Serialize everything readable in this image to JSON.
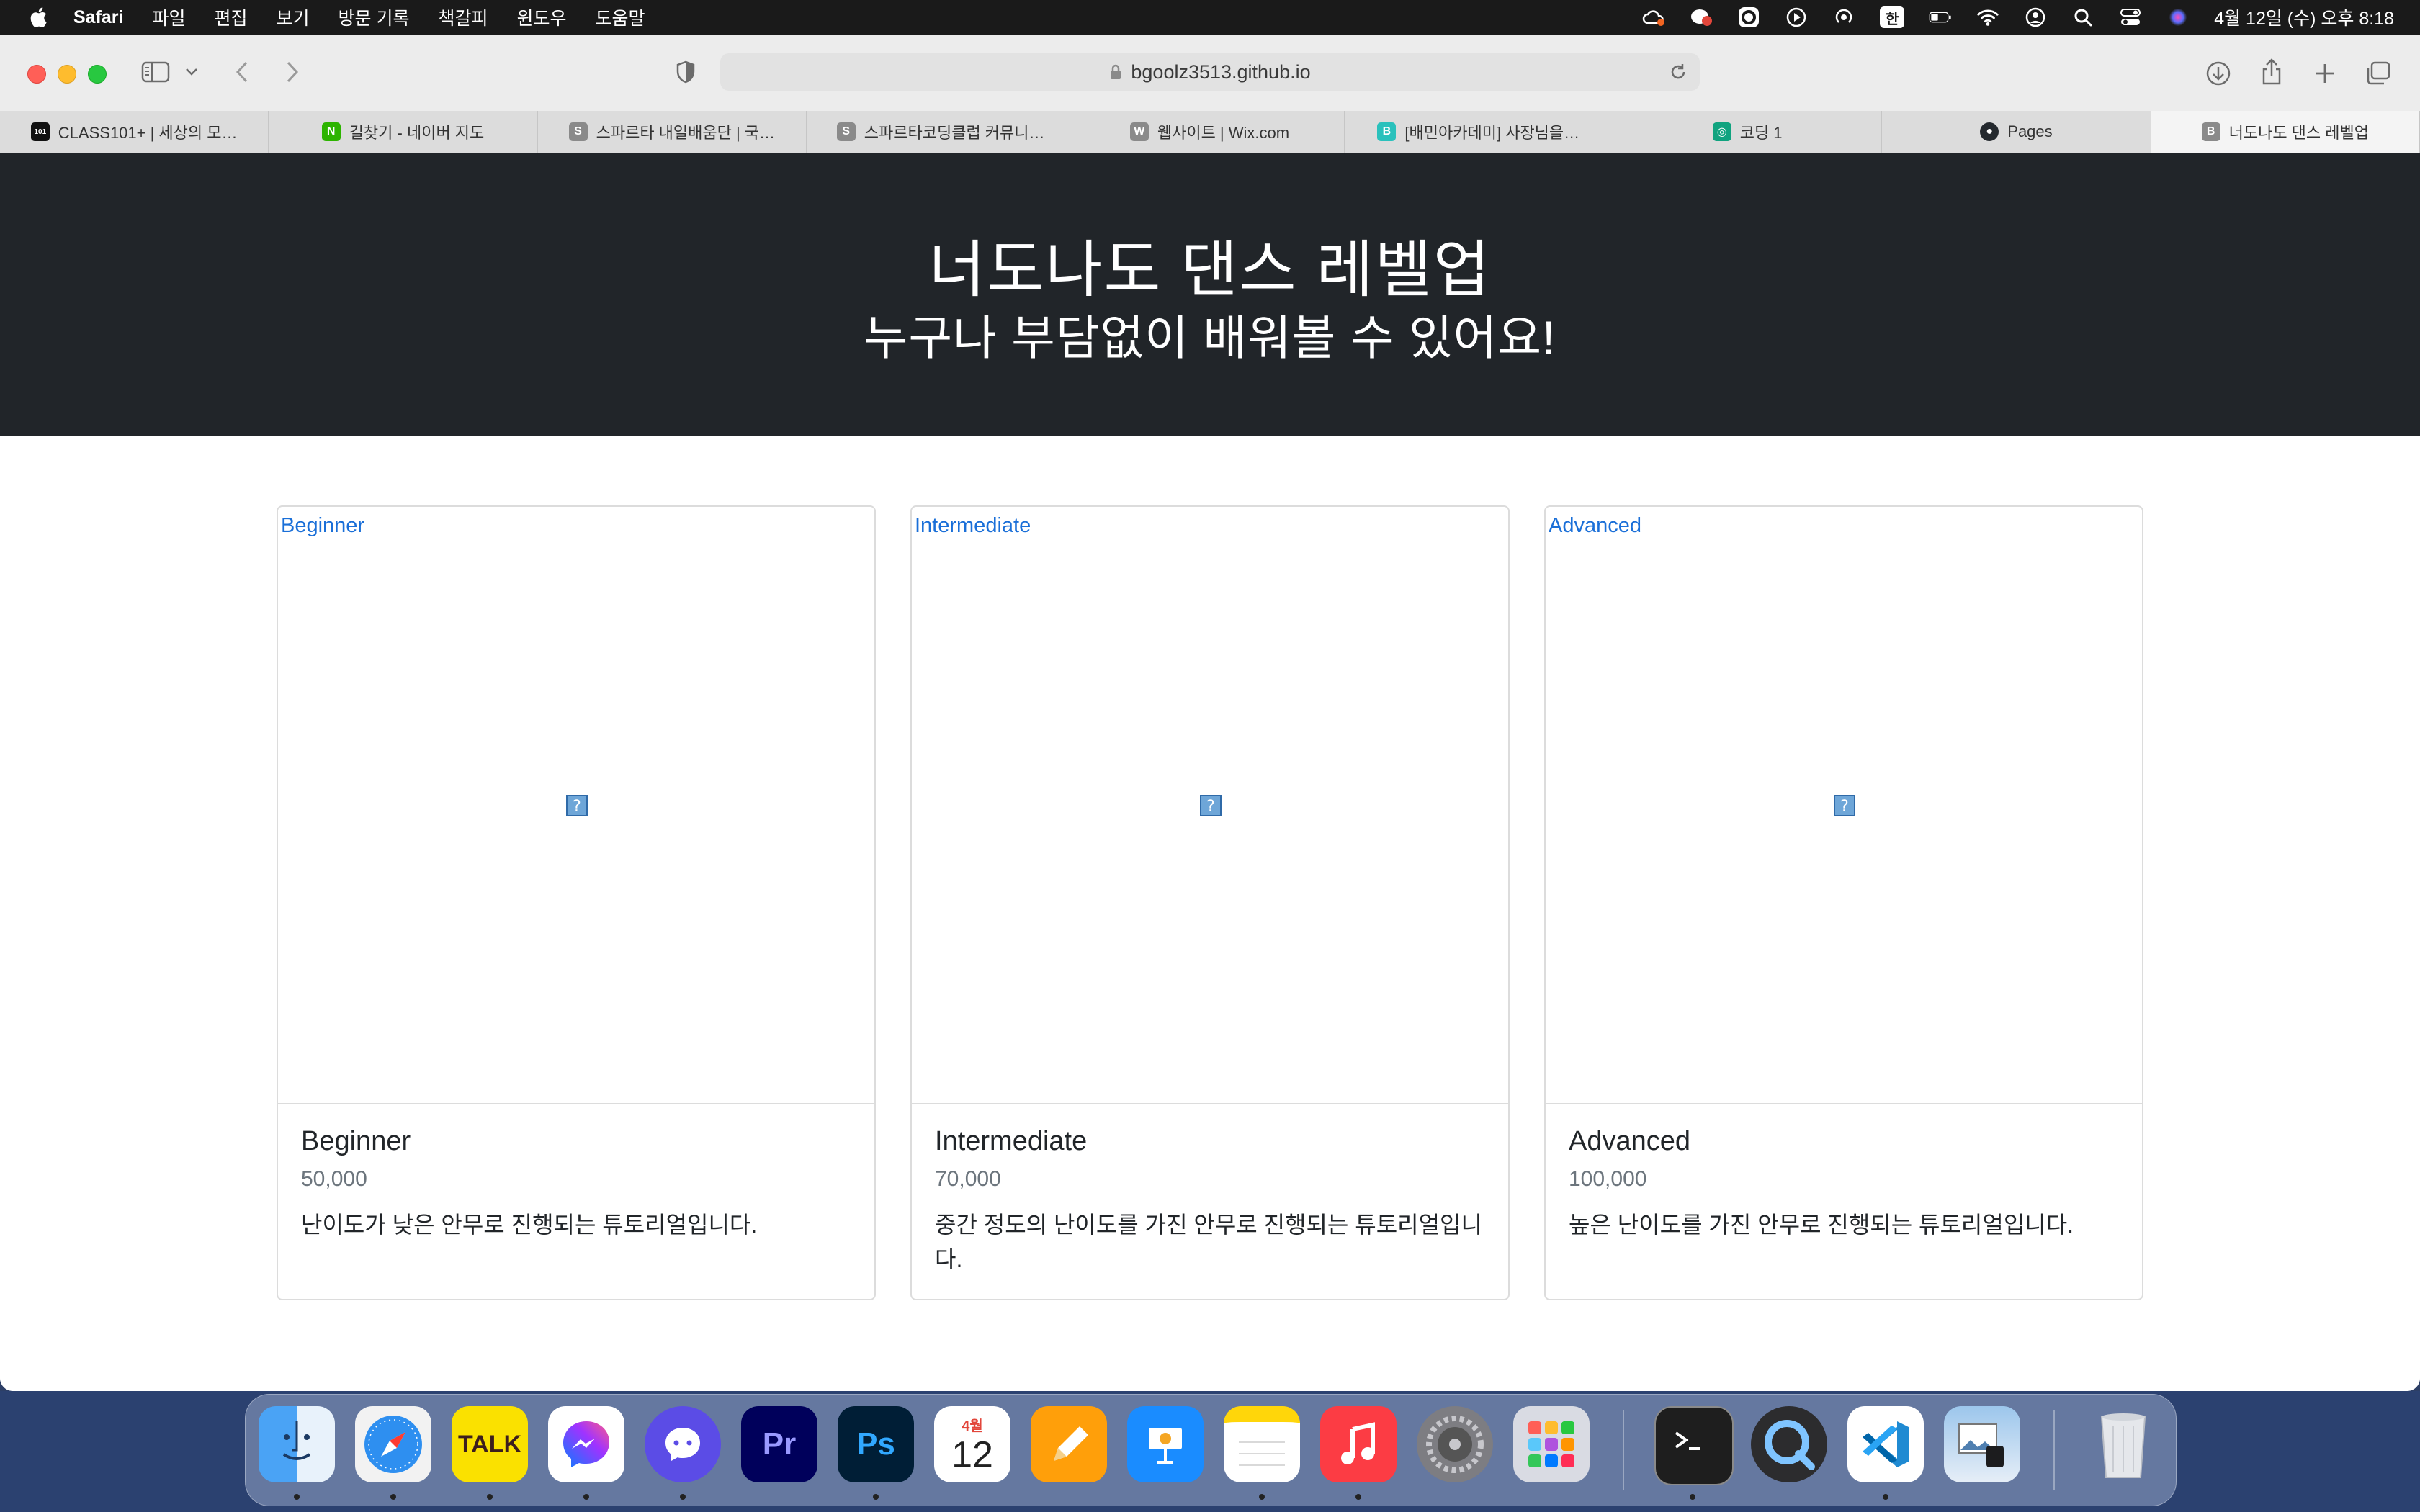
{
  "menubar": {
    "app": "Safari",
    "items": [
      "파일",
      "편집",
      "보기",
      "방문 기록",
      "책갈피",
      "윈도우",
      "도움말"
    ],
    "ime": "한",
    "clock": "4월 12일 (수) 오후 8:18"
  },
  "toolbar": {
    "url": "bgoolz3513.github.io"
  },
  "tabs": [
    {
      "label": "CLASS101+ | 세상의 모…",
      "favicon": "101",
      "color": "#111111"
    },
    {
      "label": "길찾기 - 네이버 지도",
      "favicon": "N",
      "color": "#2db400"
    },
    {
      "label": "스파르타 내일배움단 | 국…",
      "favicon": "S",
      "color": "#8a8a8a"
    },
    {
      "label": "스파르타코딩클럽 커뮤니…",
      "favicon": "S",
      "color": "#8a8a8a"
    },
    {
      "label": "웹사이트 | Wix.com",
      "favicon": "W",
      "color": "#8a8a8a"
    },
    {
      "label": "[배민아카데미] 사장님을…",
      "favicon": "B",
      "color": "#2ac1bc"
    },
    {
      "label": "코딩 1",
      "favicon": "◎",
      "color": "#10a37f"
    },
    {
      "label": "Pages",
      "favicon": "●",
      "color": "#24292e"
    },
    {
      "label": "너도나도 댄스 레벨업",
      "favicon": "B",
      "color": "#8a8a8a"
    }
  ],
  "hero": {
    "title": "너도나도 댄스 레벨업",
    "subtitle": "누구나 부담없이 배워볼 수 있어요!"
  },
  "cards": [
    {
      "alt": "Beginner",
      "title": "Beginner",
      "price": "50,000",
      "desc": "난이도가 낮은 안무로 진행되는 튜토리얼입니다."
    },
    {
      "alt": "Intermediate",
      "title": "Intermediate",
      "price": "70,000",
      "desc": "중간 정도의 난이도를 가진 안무로 진행되는 튜토리얼입니다."
    },
    {
      "alt": "Advanced",
      "title": "Advanced",
      "price": "100,000",
      "desc": "높은 난이도를 가진 안무로 진행되는 튜토리얼입니다."
    }
  ],
  "dock": {
    "calendar_month": "4월",
    "calendar_day": "12",
    "talk": "TALK",
    "premiere": "Pr",
    "photoshop": "Ps"
  }
}
